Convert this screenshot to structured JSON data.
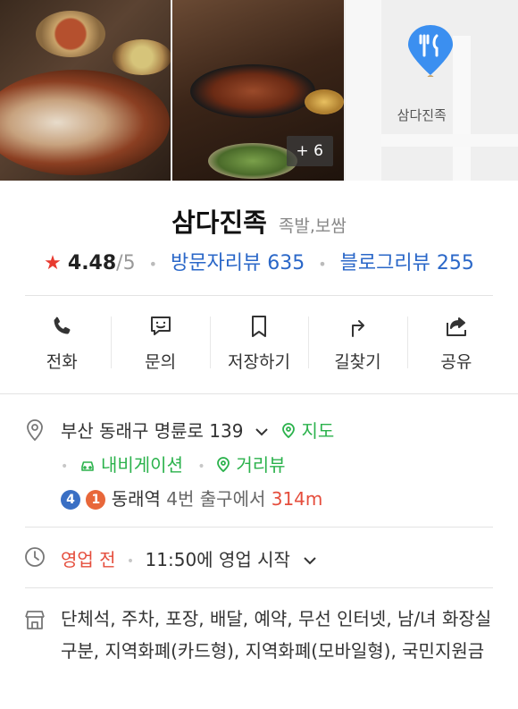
{
  "photos": {
    "more_count": "+ 6",
    "map_label": "삼다진족"
  },
  "place": {
    "name": "삼다진족",
    "category": "족발,보쌈",
    "rating": "4.48",
    "rating_max": "/5",
    "visitor_reviews": "방문자리뷰 635",
    "blog_reviews": "블로그리뷰 255"
  },
  "actions": [
    {
      "label": "전화",
      "icon": "phone-icon"
    },
    {
      "label": "문의",
      "icon": "chat-icon"
    },
    {
      "label": "저장하기",
      "icon": "bookmark-icon"
    },
    {
      "label": "길찾기",
      "icon": "directions-icon"
    },
    {
      "label": "공유",
      "icon": "share-icon"
    }
  ],
  "address": {
    "text": "부산 동래구 명륜로 139",
    "map_link": "지도",
    "navigation_link": "내비게이션",
    "street_view_link": "거리뷰",
    "line_4": "4",
    "line_1": "1",
    "station": "동래역",
    "exit_text": "4번 출구에서",
    "distance": "314m"
  },
  "hours": {
    "status": "영업 전",
    "detail": "11:50에 영업 시작"
  },
  "facilities": {
    "text": "단체석, 주차, 포장, 배달, 예약, 무선 인터넷, 남/녀 화장실 구분, 지역화폐(카드형), 지역화폐(모바일형), 국민지원금"
  },
  "colors": {
    "accent_green": "#2bb24c",
    "link_blue": "#2a67c8",
    "star_red": "#e83a2f",
    "line4_blue": "#3a6fc4",
    "line1_orange": "#e8673a"
  }
}
